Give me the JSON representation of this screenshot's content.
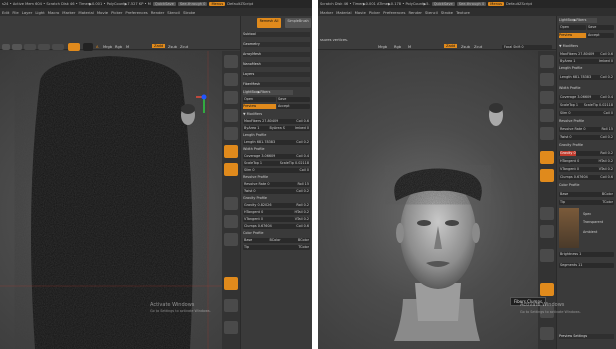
{
  "left": {
    "titlebar": [
      "s24 • Active Mem 604 • Scratch Disk 46 • Timer▶0.001 • PolyCount▶7.527 KP • M",
      "QuickSave",
      "See-through 0",
      "Menus",
      "DefaultZScript"
    ],
    "menubar": [
      "Edit",
      "File",
      "Layer",
      "Light",
      "Macro",
      "Marker",
      "Material",
      "Movie",
      "Picker",
      "Preferences",
      "Render",
      "Stencil",
      "Stroke"
    ],
    "toolbar": {
      "a_label": "A",
      "mrgb": "Mrgb",
      "rgb": "Rgb",
      "m": "M",
      "zadd": "Zadd",
      "zsub": "Zsub",
      "zcut": "Zcut",
      "rgb_intensity": "Rgb Intensity",
      "z_intensity": "Z Intensity 25",
      "focal_shift": "Focal Shift 0",
      "draw_size": "Draw Size 64",
      "tools": [
        "Move",
        "Scale",
        "Rotate"
      ]
    },
    "top_right_buttons": [
      "Remesh All",
      "SimpleBrush",
      "Subtool",
      "Geometry",
      "ArrayMesh",
      "NanoMesh",
      "Layers",
      "FiberMesh"
    ],
    "fibermesh": {
      "lightbox": "LightBox▶Fibers",
      "open": "Open",
      "save": "Save",
      "preview": "Preview",
      "accept": "Accept",
      "modifiers": "▼ Modifiers",
      "max_fibers": "MaxFibers 27.80409",
      "coil": "Coil 0.6",
      "byarea": "ByArea 1",
      "byarea_s": "ByArea S",
      "imbed": "Imbed 0",
      "length_profile": "Length Profile",
      "length": "Length 681.78383",
      "coil2": "Coil 0.2",
      "width_profile": "Width Profile",
      "coverage": "Coverage 3.06609",
      "coil3": "Coil 0.4",
      "scale_top": "ScaleTop 1",
      "scale_tip": "ScaleTip 0.02118",
      "slim": "Slim 0",
      "coil4": "Coil 0",
      "revolve_profile": "Revolve Profile",
      "revolve_rate": "Revolve Rate 0",
      "roll": "Roll 15",
      "twist": "Twist 0",
      "coil5": "Coil 0.2",
      "gravity_profile": "Gravity Profile",
      "gravity": "Gravity 0.82026",
      "roll2": "Roll 0.2",
      "htangent": "HTangent 0",
      "htail": "HTail 0.2",
      "vtangent": "VTangent 0",
      "vtail": "VTail 0.2",
      "clumps": "Clumps 0.67604",
      "clump_coil": "Coil 0.6",
      "color_profile": "Color Profile",
      "base": "Base",
      "bcolor": "BColor",
      "bcolor2": "BColor",
      "tip": "Tip",
      "tcolor": "TColor"
    },
    "shelf": [
      "Move",
      "Scale",
      "Rotate",
      "Poly F",
      "Transp",
      "Ghost",
      "Solo",
      "Xpose"
    ],
    "watermark": "Activate Windows",
    "watermark_sub": "Go to Settings to activate Windows."
  },
  "right": {
    "titlebar": [
      "Scratch Disk 46 • Timer▶0.001 ATime▶0.178 • PolyCount▶5.",
      "QuickSave",
      "See-through 0",
      "Menus",
      "DefaultZScript"
    ],
    "menubar": [
      "Marker",
      "Material",
      "Movie",
      "Picker",
      "Preferences",
      "Render",
      "Stencil",
      "Stroke",
      "Texture"
    ],
    "toolbar_left_text": "ssures vertices.",
    "toolbar": {
      "mrgb": "Mrgb",
      "rgb": "Rgb",
      "m": "M",
      "zadd": "Zadd",
      "zsub": "Zsub",
      "zcut": "Zcut",
      "z_intensity": "Z Intensity 25",
      "focal_shift": "Focal Shift 0",
      "draw_size": "Draw Size 64",
      "dynamic": "Dynamic"
    },
    "fibermesh": {
      "lightbox": "LightBox▶Fibers",
      "open": "Open",
      "save": "Save",
      "preview": "Preview",
      "accept": "Accept",
      "modifiers": "▼ Modifiers",
      "max_fibers": "MaxFibers 27.80409",
      "coil": "Coil 0.6",
      "byarea": "ByArea 1",
      "byarea_s": "ByArea S",
      "imbed": "Imbed 0",
      "length_profile": "Length Profile",
      "length": "Length 681.78383",
      "coil2": "Coil 0.2",
      "width_profile": "Width Profile",
      "coverage": "Coverage 3.06609",
      "coil3": "Coil 0.4",
      "scale_top": "ScaleTop 1",
      "scale_tip": "ScaleTip 0.02118",
      "slim": "Slim 0",
      "coil4": "Coil 0",
      "revolve_profile": "Revolve Profile",
      "revolve_rate": "Revolve Rate 0",
      "roll": "Roll 15",
      "twist": "Twist 0",
      "coil5": "Coil 0.2",
      "gravity_profile": "Gravity Profile",
      "gravity": "Gravity 0",
      "roll2": "Roll 0.2",
      "htangent": "HTangent 0",
      "htail": "HTail 0.2",
      "vtangent": "VTangent 0",
      "vtail": "VTail 0.2",
      "clumps": "Clumps 0.67604",
      "clump_coil": "Coil 0.6",
      "color_profile": "Color Profile",
      "base": "Base",
      "bcolor": "BColor",
      "tip": "Tip",
      "tcolor": "TColor",
      "spec": "Spec",
      "transparent": "Transparent",
      "ambient": "Ambient",
      "brightness": "Brightness 1",
      "segments": "Segments 11",
      "preview_settings": "Preview Settings"
    },
    "tooltip": "Fibers Clumps",
    "watermark": "Activate Windows",
    "watermark_sub": "Go to Settings to activate Windows."
  },
  "colors": {
    "accent": "#e08a1c",
    "bg": "#3a3a3a",
    "panel_dark": "#2a2a2a"
  }
}
